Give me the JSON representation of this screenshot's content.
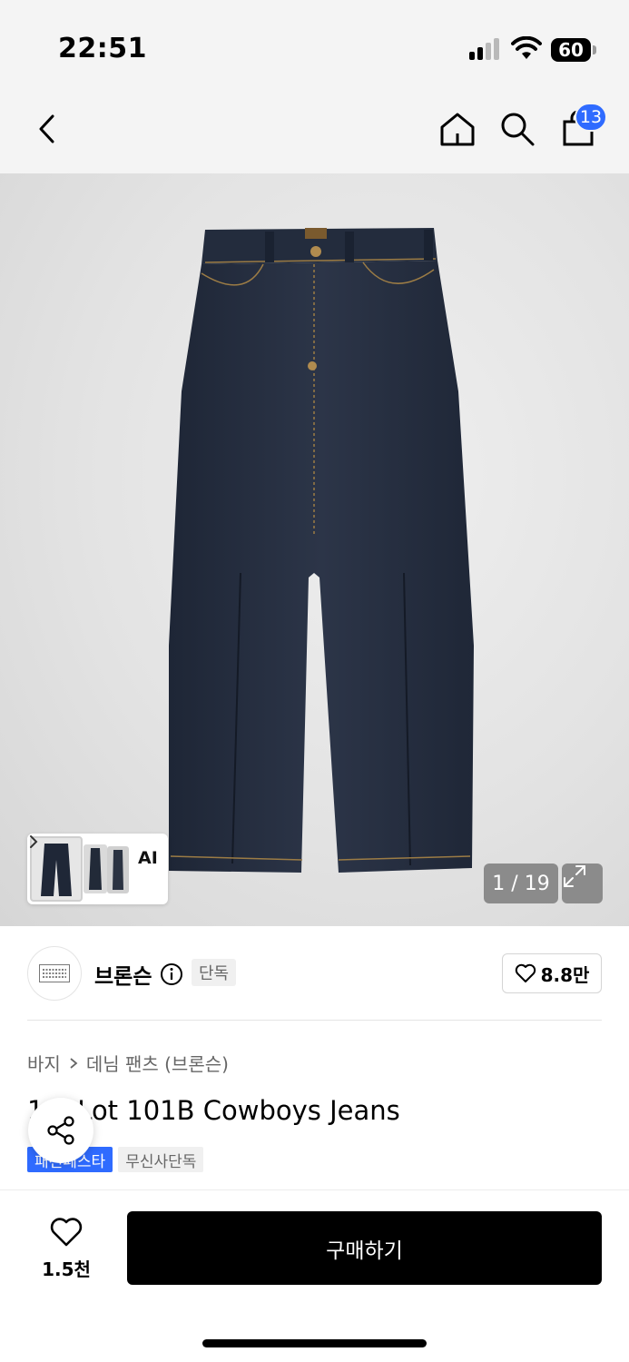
{
  "status_bar": {
    "time": "22:51",
    "battery": "60",
    "icons": [
      "signal-icon",
      "wifi-icon",
      "battery-icon"
    ]
  },
  "top_nav": {
    "icons": [
      "back-arrow-icon",
      "home-icon",
      "search-icon",
      "shopping-bag-icon"
    ],
    "cart_count": "13"
  },
  "gallery": {
    "ai_label": "AI",
    "page_counter": "1 / 19",
    "icons": [
      "chevron-right-icon",
      "expand-icon"
    ]
  },
  "brand": {
    "name": "브론슨",
    "tag": "단독",
    "like_count": "8.8만",
    "icons": [
      "info-icon",
      "heart-icon"
    ]
  },
  "product": {
    "breadcrumb": [
      "바지",
      "데님 팬츠 (브론슨)"
    ],
    "title": "1   S Lot 101B Cowboys Jeans",
    "badges": [
      "패션페스타",
      "무신사단독"
    ]
  },
  "action_bar": {
    "like_count": "1.5천",
    "buy_label": "구매하기",
    "icons": [
      "share-icon",
      "heart-icon"
    ]
  },
  "colors": {
    "accent_blue": "#2f6bff",
    "buy_button": "#000000",
    "nav_background": "#f4f4f4"
  }
}
